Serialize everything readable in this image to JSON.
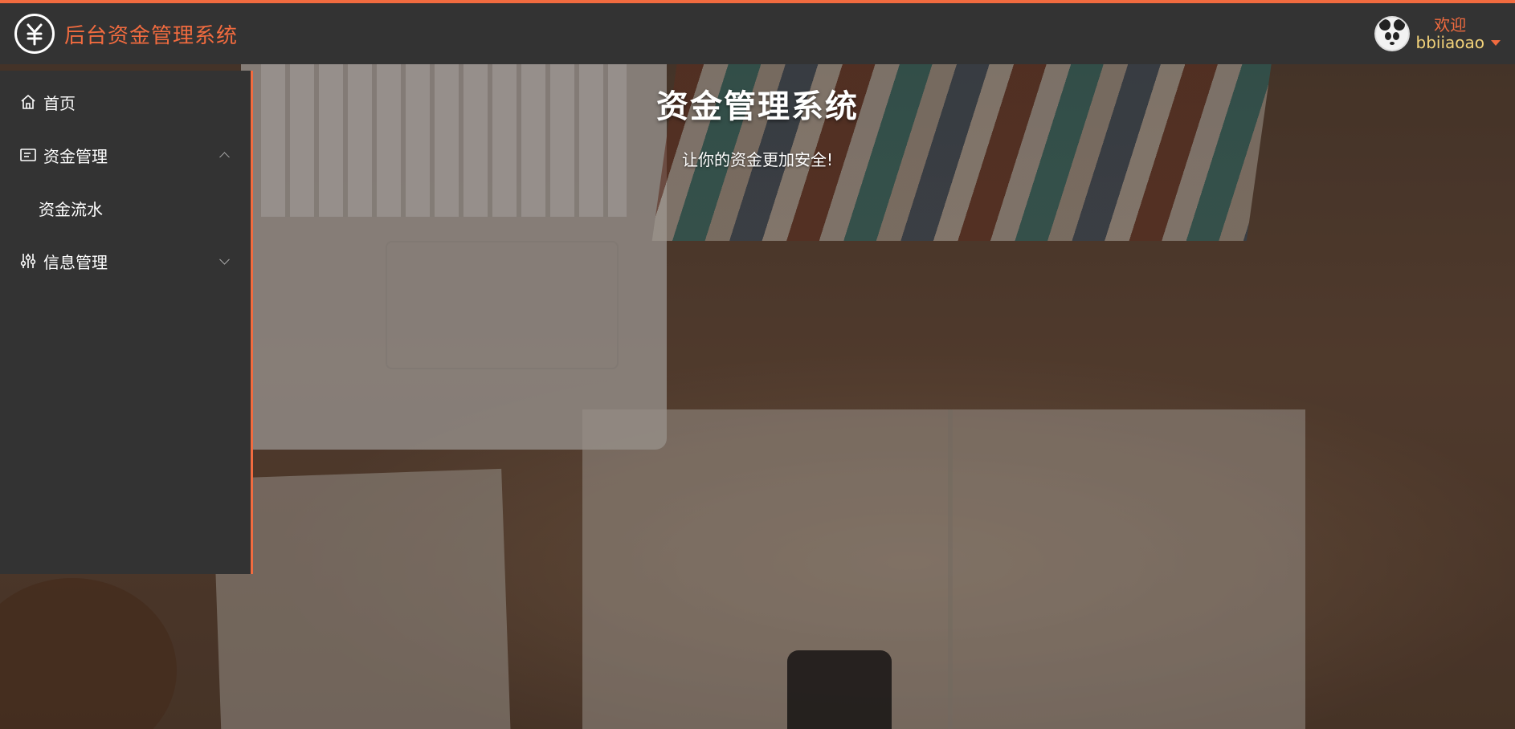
{
  "header": {
    "logo_icon": "yuan-circle-icon",
    "logo_glyph": "¥",
    "title": "后台资金管理系统",
    "welcome": "欢迎",
    "username": "bbiiaoao",
    "avatar": "panda-avatar"
  },
  "hero": {
    "title": "资金管理系统",
    "subtitle": "让你的资金更加安全!"
  },
  "sidebar": {
    "items": [
      {
        "label": "首页",
        "icon": "home-icon"
      },
      {
        "label": "资金管理",
        "icon": "fund-list-icon",
        "expanded": true,
        "children": [
          {
            "label": "资金流水"
          }
        ]
      },
      {
        "label": "信息管理",
        "icon": "sliders-icon",
        "expanded": false
      }
    ]
  },
  "colors": {
    "accent": "#f16b3f",
    "header_bg": "#333333",
    "sidebar_bg": "#333333",
    "username_color": "#f3d37a"
  }
}
